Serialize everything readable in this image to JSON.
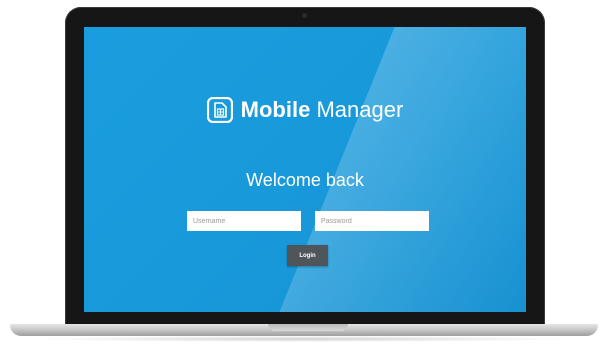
{
  "app": {
    "brand_bold": "Mobile",
    "brand_light": "Manager",
    "logo_icon": "sim-card-icon"
  },
  "login": {
    "heading": "Welcome back",
    "username_placeholder": "Username",
    "password_placeholder": "Password",
    "submit_label": "Login"
  },
  "colors": {
    "screen_bg": "#1a9dde",
    "button_bg": "#4f565b",
    "text": "#ffffff"
  }
}
